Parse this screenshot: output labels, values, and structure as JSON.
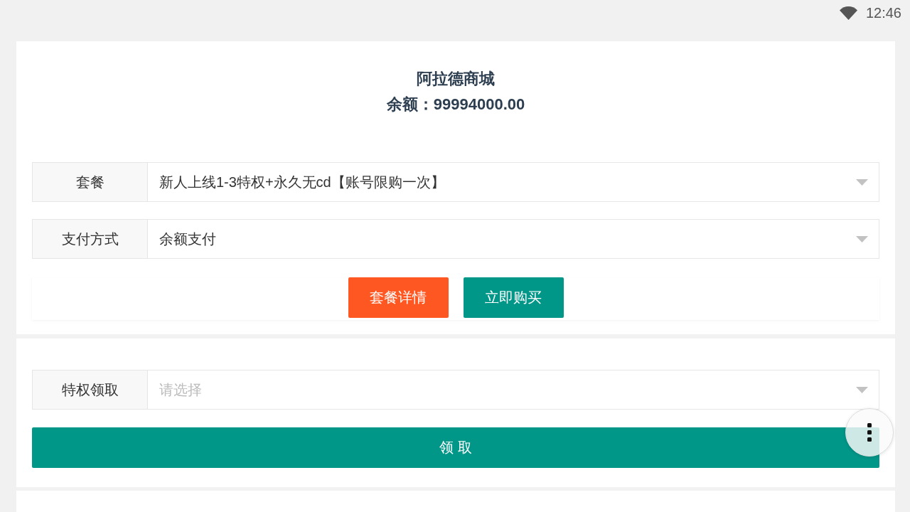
{
  "status_bar": {
    "time": "12:46"
  },
  "header": {
    "title": "阿拉德商城",
    "balance": "余额：99994000.00"
  },
  "purchase_form": {
    "fields": [
      {
        "label": "套餐",
        "value": "新人上线1-3特权+永久无cd【账号限购一次】"
      },
      {
        "label": "支付方式",
        "value": "余额支付"
      }
    ],
    "buttons": [
      {
        "label": "套餐详情",
        "kind": "warning"
      },
      {
        "label": "立即购买",
        "kind": "primary"
      }
    ]
  },
  "claim_form": {
    "fields": [
      {
        "label": "特权领取",
        "placeholder": "请选择"
      }
    ],
    "button": {
      "label": "领 取"
    }
  }
}
